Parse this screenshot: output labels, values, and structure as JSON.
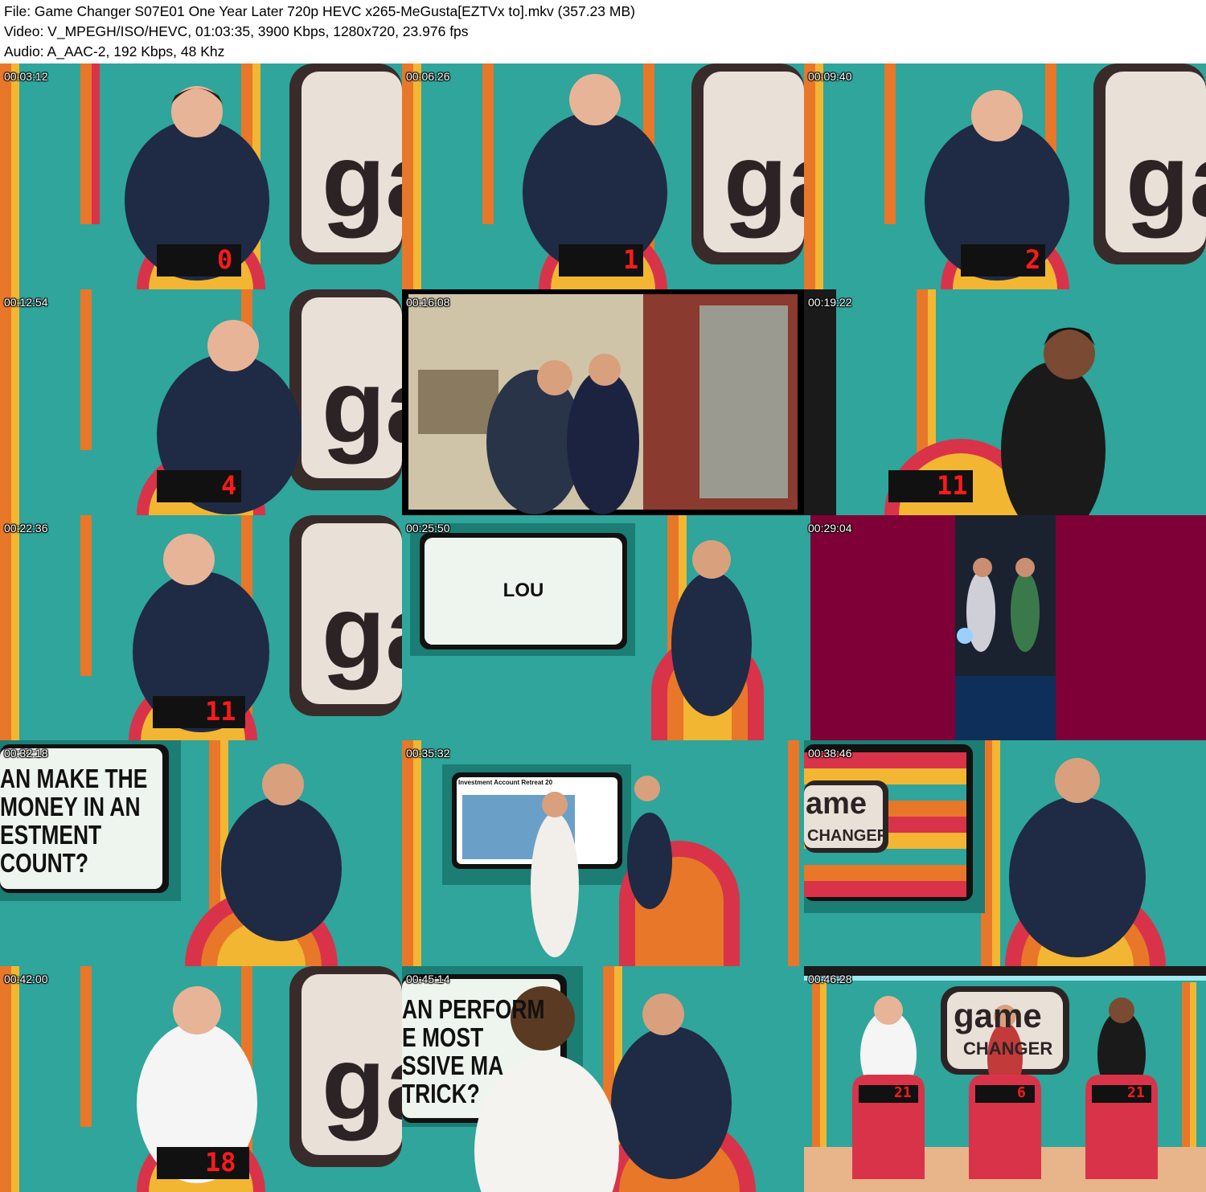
{
  "header": {
    "file_line": "File: Game Changer S07E01 One Year Later 720p HEVC x265-MeGusta[EZTVx to].mkv (357.23 MB)",
    "video_line": "Video: V_MPEGH/ISO/HEVC, 01:03:35, 3900 Kbps, 1280x720, 23.976 fps",
    "audio_line": "Audio: A_AAC-2, 192 Kbps, 48 Khz"
  },
  "thumbnails": [
    {
      "timestamp": "00:03:12",
      "score": "0"
    },
    {
      "timestamp": "00:06:26",
      "score": "1"
    },
    {
      "timestamp": "00:09:40",
      "score": "2"
    },
    {
      "timestamp": "00:12:54",
      "score": "4"
    },
    {
      "timestamp": "00:16:08"
    },
    {
      "timestamp": "00:19:22",
      "score": "11"
    },
    {
      "timestamp": "00:22:36",
      "score": "11"
    },
    {
      "timestamp": "00:25:50",
      "screen_text": "LOU"
    },
    {
      "timestamp": "00:29:04"
    },
    {
      "timestamp": "00:32:18",
      "screen_lines": [
        "AN MAKE THE",
        "MONEY IN AN",
        "ESTMENT",
        "COUNT?"
      ]
    },
    {
      "timestamp": "00:35:32",
      "screen_text": "Investment Account Retreat 20"
    },
    {
      "timestamp": "00:38:46",
      "logo_top": "ame",
      "logo_bottom": "CHANGER"
    },
    {
      "timestamp": "00:42:00",
      "score": "18"
    },
    {
      "timestamp": "00:45:14",
      "screen_lines": [
        "AN PERFORM",
        "E MOST",
        "SSIVE MA",
        "TRICK?"
      ]
    },
    {
      "timestamp": "00:46:28",
      "scores": [
        "21",
        "6",
        "21"
      ],
      "logo_top": "game",
      "logo_bottom": "CHANGER"
    }
  ],
  "colors": {
    "set_teal": "#2fa59b",
    "stripe_orange": "#e8772a",
    "stripe_yellow": "#f2b632",
    "stripe_red": "#d9334a",
    "maroon": "#7e0037",
    "score_red": "#ff1a1a"
  }
}
